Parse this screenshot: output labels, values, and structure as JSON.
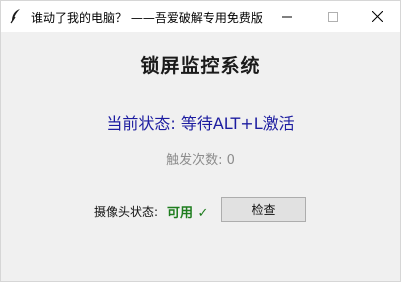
{
  "window": {
    "title": "谁动了我的电脑？ ——吾爱破解专用免费版",
    "icon": "feather-icon",
    "controls": [
      "minimize-icon",
      "maximize-icon",
      "close-icon"
    ]
  },
  "app": {
    "heading": "锁屏监控系统",
    "status_text": "当前状态: 等待ALT+L激活",
    "trigger_count_text": "触发次数: 0",
    "camera_label": "摄像头状态:",
    "camera_value": "可用 ✓",
    "check_button_label": "检查"
  },
  "colors": {
    "status": "#1c1ca0",
    "count": "#8c8c8c",
    "camera_ok": "#1e7d1e",
    "window_bg": "#f0f0f0"
  }
}
